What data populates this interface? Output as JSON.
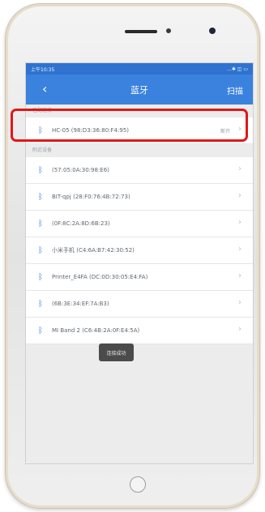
{
  "status_bar": {
    "time": "上午10:35",
    "icons": "...✱ ◫ ▭"
  },
  "header": {
    "back_icon": "chevron-left-icon",
    "title": "蓝牙",
    "scan_label": "扫描"
  },
  "paired_section": {
    "label": "已配连接",
    "devices": [
      {
        "name": "HC-05  (98:D3:36:80:F4:95)",
        "status": "断开"
      }
    ]
  },
  "available_section": {
    "label": "附近设备",
    "devices": [
      {
        "name": "(57:05:0A:30:98:E6)"
      },
      {
        "name": "BIT-qpj  (28:F0:76:4B:72:73)"
      },
      {
        "name": "(0F:8C:2A:8D:6B:23)"
      },
      {
        "name": "小米手机  (C4:6A:B7:42:30:52)"
      },
      {
        "name": "Printer_E4FA  (DC:0D:30:05:E4:FA)"
      },
      {
        "name": "(6B:3E:34:EF:7A:B3)"
      },
      {
        "name": "MI Band 2  (C6:4B:2A:0F:E4:5A)"
      }
    ]
  },
  "toast": {
    "text": "连接成功"
  },
  "colors": {
    "accent": "#3a82dd",
    "highlight": "#e01818"
  }
}
